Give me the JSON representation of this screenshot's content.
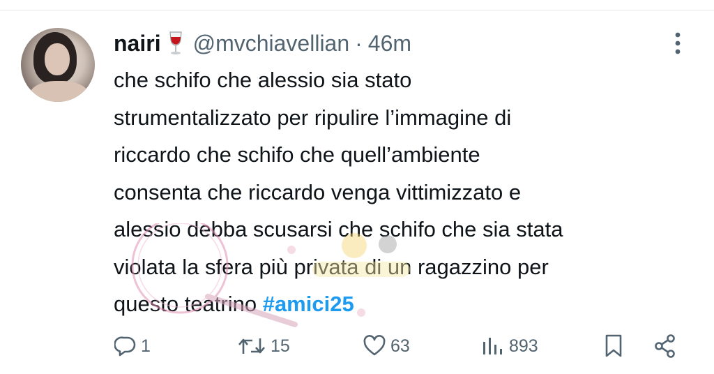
{
  "tweet": {
    "display_name": "nairi",
    "name_emoji": "wine-glass-icon",
    "handle": "@mvchiavellian",
    "separator": "·",
    "time": "46m",
    "text_before_hashtag": "che schifo che alessio sia stato\nstrumentalizzato per ripulire l’immagine di\nriccardo che schifo che quell’ambiente\nconsenta che riccardo venga vittimizzato e\nalessio debba scusarsi che schifo che sia stata\nviolata la sfera più privata di un ragazzino per\nquesto teatrino ",
    "hashtag": "#amici25"
  },
  "actions": {
    "replies": "1",
    "reposts": "15",
    "likes": "63",
    "views": "893"
  },
  "colors": {
    "text": "#0f1419",
    "secondary": "#536471",
    "link": "#1d9bf0",
    "divider": "#e6e9ec"
  }
}
